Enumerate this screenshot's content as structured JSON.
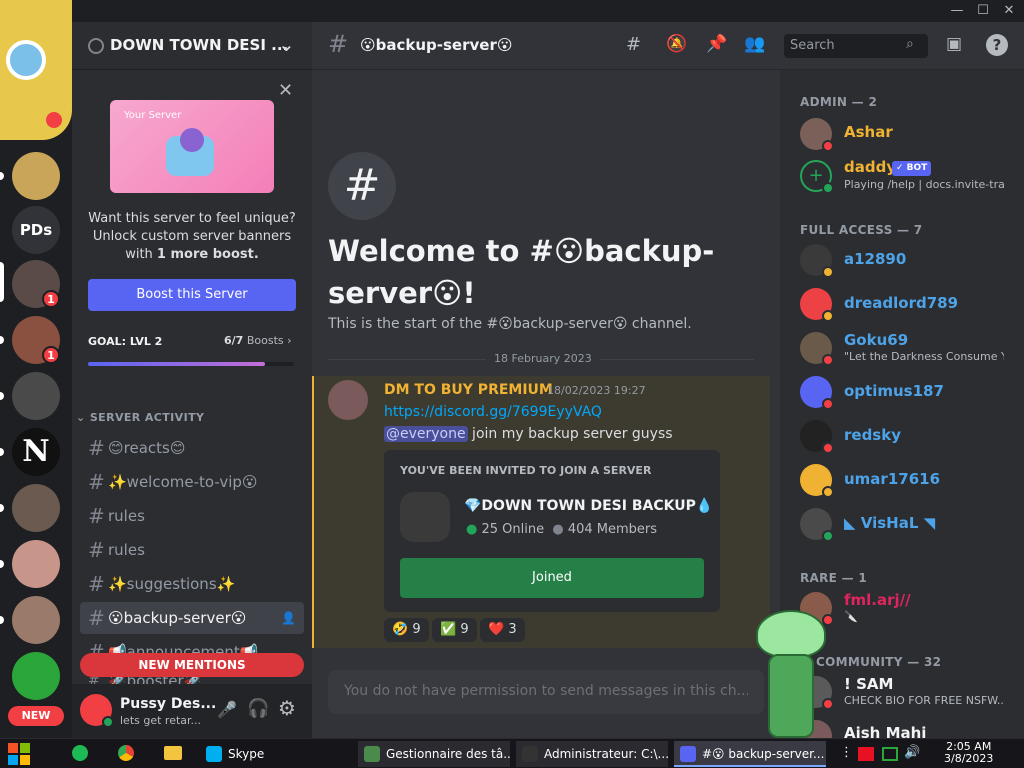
{
  "window": {
    "controls": [
      "—",
      "☐",
      "✕"
    ]
  },
  "servers": [
    {
      "label": "",
      "color": "#c9a55a",
      "badge": ""
    },
    {
      "label": "PDs",
      "color": "#313338",
      "badge": ""
    },
    {
      "label": "",
      "color": "#5a4a48",
      "badge": "1"
    },
    {
      "label": "",
      "color": "#8a5040",
      "badge": "1"
    },
    {
      "label": "",
      "color": "#4a4a4a",
      "badge": ""
    },
    {
      "label": "N",
      "color": "#111",
      "badge": ""
    },
    {
      "label": "",
      "color": "#6a5a50",
      "badge": ""
    },
    {
      "label": "",
      "color": "#c8958a",
      "badge": ""
    },
    {
      "label": "",
      "color": "#9a7a6a",
      "badge": ""
    },
    {
      "label": "",
      "color": "#2aa63a",
      "badge": ""
    }
  ],
  "new_badge": "NEW",
  "server": {
    "name": "DOWN TOWN DESI ...",
    "chevron": "⌄"
  },
  "boost_card": {
    "banner_title": "Your Server",
    "line1": "Want this server to feel unique?",
    "line2": "Unlock custom server banners",
    "line3_prefix": "with ",
    "line3_bold": "1 more boost.",
    "button": "Boost this Server",
    "goal": "GOAL: LVL 2",
    "boosts": "6/7",
    "boosts_suffix": "Boosts",
    "progress": 0.86
  },
  "category": "SERVER ACTIVITY",
  "channels": [
    {
      "name": "😊reacts😊",
      "active": false
    },
    {
      "name": "✨welcome-to-vip😮",
      "active": false
    },
    {
      "name": "  rules",
      "active": false
    },
    {
      "name": "rules",
      "active": false
    },
    {
      "name": "✨suggestions✨",
      "active": false
    },
    {
      "name": "😮backup-server😮",
      "active": true
    },
    {
      "name": "📢announcement📢",
      "active": false
    },
    {
      "name": "🚀booster🚀",
      "active": false
    }
  ],
  "new_mentions": "NEW MENTIONS",
  "user": {
    "name": "Pussy Des...",
    "status": "lets get retar..."
  },
  "channel_header": {
    "name": "😮backup-server😮",
    "search_placeholder": "Search"
  },
  "welcome": {
    "title_line1": "Welcome to #😮backup-",
    "title_line2": "server😮!",
    "subtitle": "This is the start of the #😮backup-server😮 channel."
  },
  "date_divider": "18 February 2023",
  "message": {
    "author": "DM TO BUY PREMIUM",
    "timestamp": "18/02/2023 19:27",
    "link": "https://discord.gg/7699EyyVAQ",
    "mention": "@everyone",
    "text": " join my backup server guyss",
    "invite": {
      "header": "YOU'VE BEEN INVITED TO JOIN A SERVER",
      "server": "💎DOWN TOWN DESI BACKUP💧",
      "online": "25 Online",
      "members": "404 Members",
      "button": "Joined"
    },
    "reactions": [
      {
        "emoji": "🤣",
        "count": "9",
        "color": "#2b2d31"
      },
      {
        "emoji": "✅",
        "count": "9",
        "color": "#2b2d31"
      },
      {
        "emoji": "❤️",
        "count": "3",
        "color": "#2b2d31"
      }
    ]
  },
  "composer_placeholder": "You do not have permission to send messages in this ch...",
  "member_groups": {
    "admin": "ADMIN — 2",
    "full": "FULL ACCESS — 7",
    "rare": "RARE — 1",
    "community": "COMMUNITY — 32"
  },
  "members": [
    {
      "name": "Ashar",
      "status": "",
      "color": "#f0b232",
      "avatar": "#7a6058",
      "dot": "#f23f43"
    },
    {
      "name": "daddy",
      "status": "Playing /help | docs.invite-tra...",
      "color": "#f0b232",
      "avatar": "#23a559",
      "dot": "#23a559",
      "bot": "✓ BOT"
    },
    {
      "name": "a12890",
      "status": "",
      "color": "#4ea3e8",
      "avatar": "#3a3a3a",
      "dot": "#f0b232"
    },
    {
      "name": "dreadlord789",
      "status": "",
      "color": "#4ea3e8",
      "avatar": "#ed4245",
      "dot": "#f0b232"
    },
    {
      "name": "Goku69",
      "status": "\"Let the Darkness Consume Y...",
      "color": "#4ea3e8",
      "avatar": "#6a5a4a",
      "dot": "#f23f43"
    },
    {
      "name": "optimus187",
      "status": "",
      "color": "#4ea3e8",
      "avatar": "#5865f2",
      "dot": "#f23f43"
    },
    {
      "name": "redsky",
      "status": "",
      "color": "#4ea3e8",
      "avatar": "#222",
      "dot": "#f23f43"
    },
    {
      "name": "umar17616",
      "status": "",
      "color": "#4ea3e8",
      "avatar": "#f0b232",
      "dot": "#f0b232"
    },
    {
      "name": "◣ VisHaL ◥",
      "status": "",
      "color": "#4ea3e8",
      "avatar": "#4a4a4a",
      "dot": "#23a559"
    },
    {
      "name": "fml.arj//",
      "status": "🔪",
      "color": "#e0245e",
      "avatar": "#8a5a4a",
      "dot": "#f23f43"
    },
    {
      "name": "! SAM",
      "status": "CHECK BIO FOR FREE NSFW...",
      "color": "#f2f3f5",
      "avatar": "#5a5a5a",
      "dot": "#f23f43"
    },
    {
      "name": "Aish Mahi",
      "status": "",
      "color": "#f2f3f5",
      "avatar": "#7a5a5a",
      "dot": "#f23f43"
    }
  ],
  "taskbar": {
    "items": [
      {
        "label": "Skype",
        "color": "#00aff0"
      },
      {
        "label": "Gestionnaire des tâ...",
        "color": "#4a8a4a"
      },
      {
        "label": "Administrateur: C:\\...",
        "color": "#333"
      },
      {
        "label": "#😮 backup-server...",
        "color": "#5865f2"
      }
    ],
    "time": "2:05 AM",
    "date": "3/8/2023"
  }
}
